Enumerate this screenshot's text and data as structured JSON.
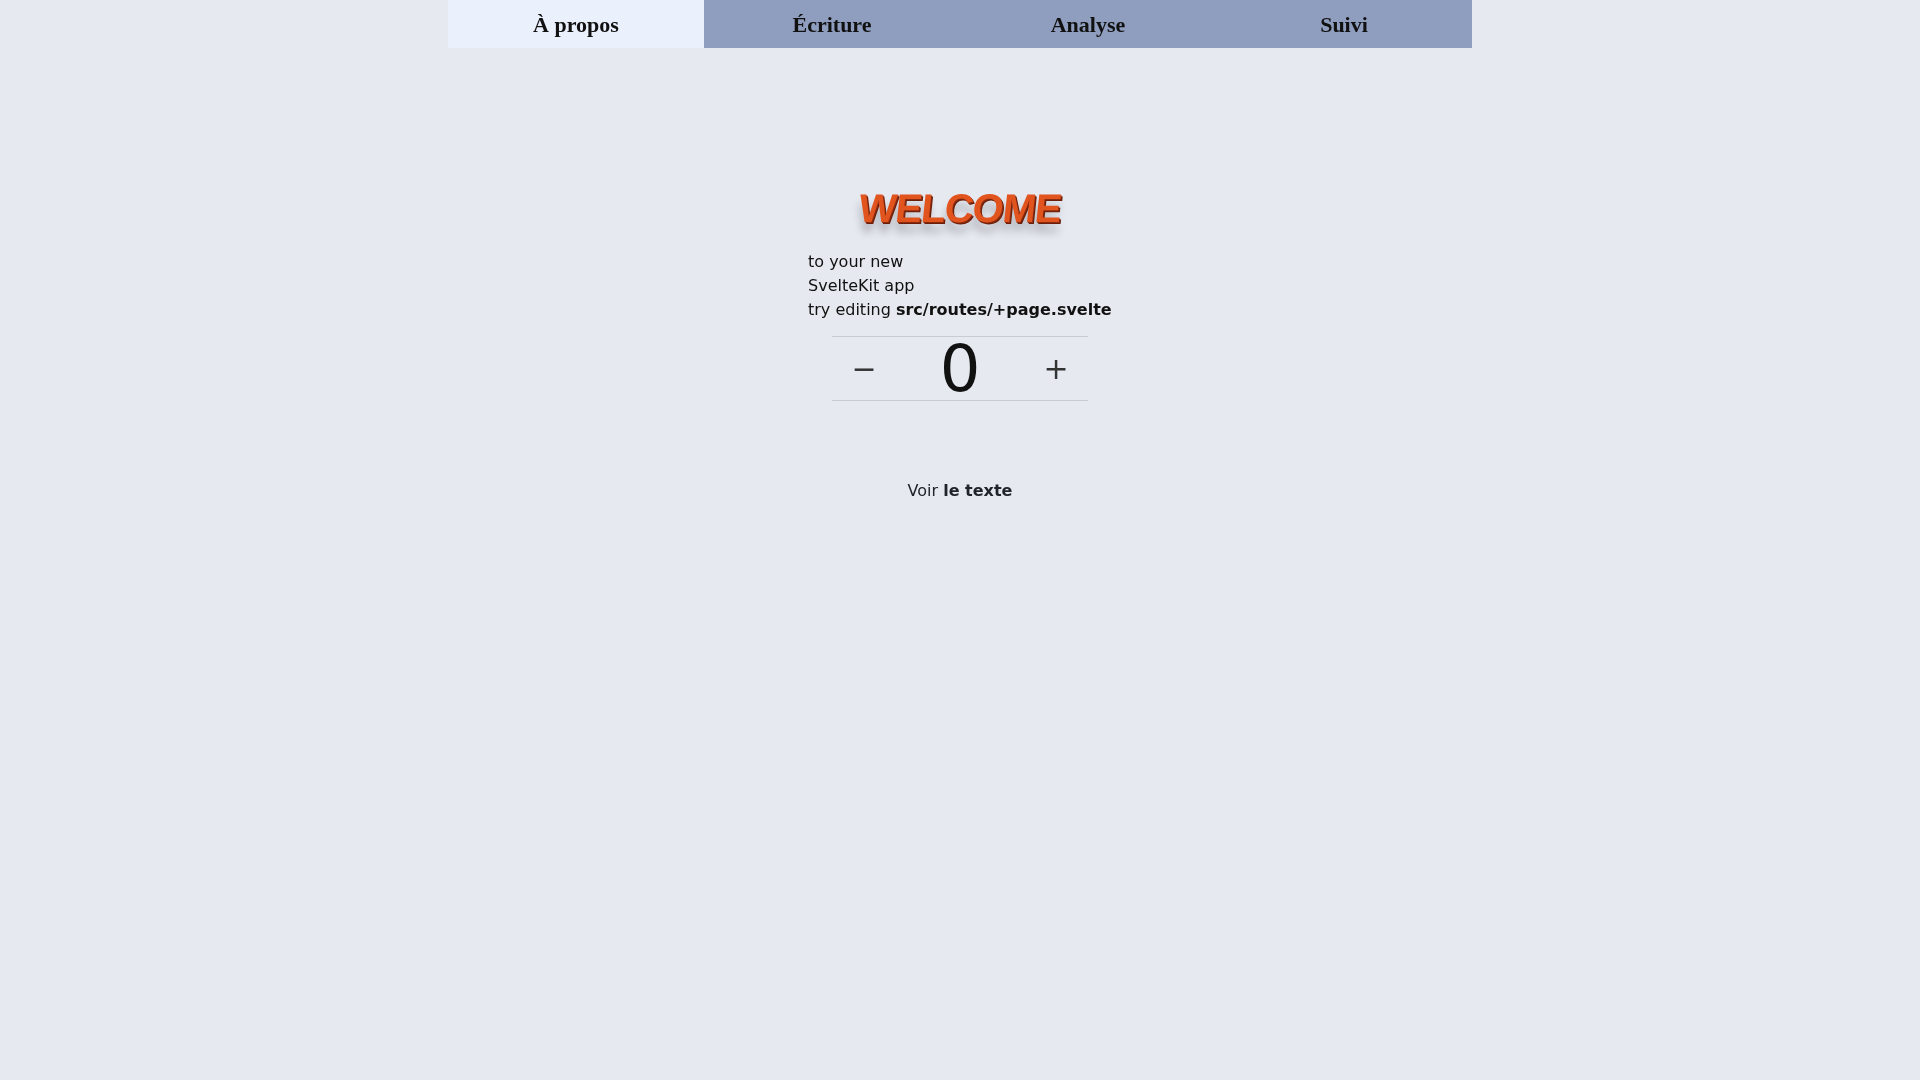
{
  "tabs": [
    {
      "label": "À propos",
      "selected": true
    },
    {
      "label": "Écriture",
      "selected": false
    },
    {
      "label": "Analyse",
      "selected": false
    },
    {
      "label": "Suivi",
      "selected": false
    }
  ],
  "logo": {
    "text": "WELCOME"
  },
  "intro": [
    "to your new",
    "SvelteKit app",
    "try editing **src/routes/+page.svelte**"
  ],
  "counter": {
    "decrement": "−",
    "value": "0",
    "increment": "+"
  },
  "link": "Voir **le texte**"
}
